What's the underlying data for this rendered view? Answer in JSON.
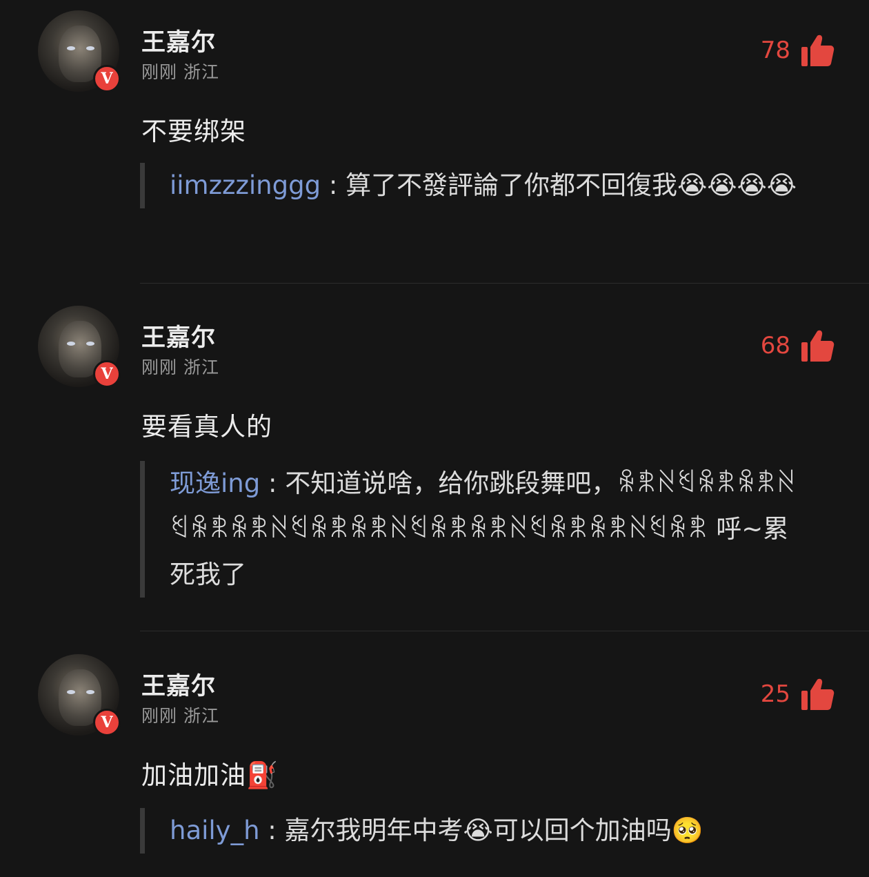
{
  "comments": [
    {
      "username": "王嘉尔",
      "meta": "刚刚 浙江",
      "verified_badge": "V",
      "likes": "78",
      "content": "不要绑架",
      "reply": {
        "name": "iimzzzinggg",
        "colon": ":",
        "text": "算了不發評論了你都不回復我😭😭😭😭"
      }
    },
    {
      "username": "王嘉尔",
      "meta": "刚刚 浙江",
      "verified_badge": "V",
      "likes": "68",
      "content": "要看真人的",
      "reply": {
        "name": "现逸ing",
        "colon": ":",
        "text": "不知道说啥，给你跳段舞吧，ꆜꉸꋊꄔꆜꉸꆜꉸꋊꄔꆜꉸꆜꉸꋊꄔꆜꉸꆜꉸꋊꄔꆜꉸꆜꉸꋊꄔꆜꉸꆜꉸꋊꄔꆜꉸ 呼~累死我了"
      }
    },
    {
      "username": "王嘉尔",
      "meta": "刚刚 浙江",
      "verified_badge": "V",
      "likes": "25",
      "content": "加油加油⛽",
      "reply": {
        "name": "haily_h",
        "colon": ":",
        "text": "嘉尔我明年中考😭可以回个加油吗🥺"
      }
    }
  ],
  "icons": {
    "like": "thumbs-up-icon",
    "like_color": "#e3473f",
    "reply_name_color": "#7e9bd6"
  }
}
